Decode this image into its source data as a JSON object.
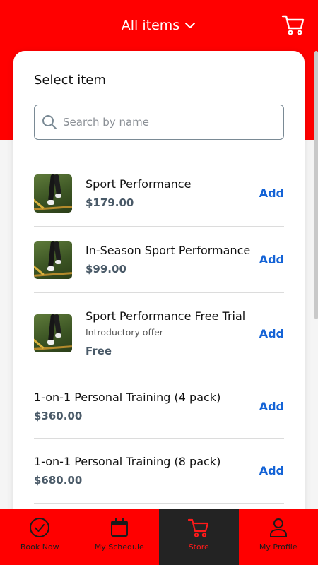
{
  "header": {
    "title": "All items",
    "cart_icon": "cart-icon",
    "dropdown_icon": "chevron-down-icon"
  },
  "panel": {
    "title": "Select item",
    "search_placeholder": "Search by name"
  },
  "items": [
    {
      "name": "Sport Performance",
      "subtitle": "",
      "price": "$179.00",
      "action": "Add",
      "has_image": true
    },
    {
      "name": "In-Season Sport Performance",
      "subtitle": "",
      "price": "$99.00",
      "action": "Add",
      "has_image": true
    },
    {
      "name": "Sport Performance Free Trial",
      "subtitle": "Introductory offer",
      "price": "Free",
      "action": "Add",
      "has_image": true
    },
    {
      "name": "1-on-1 Personal Training (4 pack)",
      "subtitle": "",
      "price": "$360.00",
      "action": "Add",
      "has_image": false
    },
    {
      "name": "1-on-1 Personal Training (8 pack)",
      "subtitle": "",
      "price": "$680.00",
      "action": "Add",
      "has_image": false
    }
  ],
  "tabs": [
    {
      "label": "Book Now",
      "icon": "check-circle-icon"
    },
    {
      "label": "My Schedule",
      "icon": "calendar-icon"
    },
    {
      "label": "Store",
      "icon": "cart-icon",
      "active": true
    },
    {
      "label": "My Profile",
      "icon": "user-icon"
    }
  ],
  "colors": {
    "brand_red": "#ff0000",
    "link_blue": "#1463d6",
    "active_tab_bg": "#232323"
  }
}
